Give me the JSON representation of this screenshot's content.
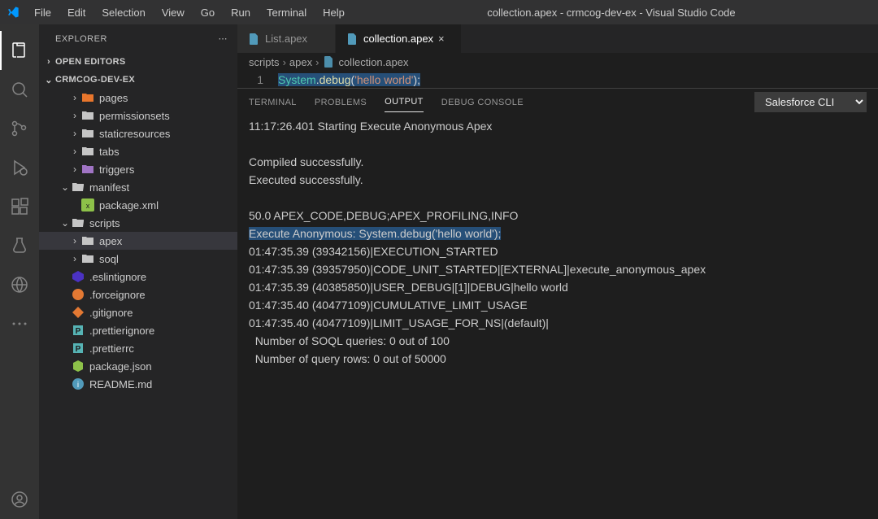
{
  "window": {
    "title": "collection.apex - crmcog-dev-ex - Visual Studio Code"
  },
  "menu": [
    "File",
    "Edit",
    "Selection",
    "View",
    "Go",
    "Run",
    "Terminal",
    "Help"
  ],
  "sidebar": {
    "title": "EXPLORER",
    "sections": {
      "open_editors": "OPEN EDITORS",
      "workspace": "CRMCOG-DEV-EX"
    },
    "tree": [
      {
        "label": "pages",
        "indent": 3,
        "chev": "right",
        "icon": "folder-orange"
      },
      {
        "label": "permissionsets",
        "indent": 3,
        "chev": "right",
        "icon": "folder-grey"
      },
      {
        "label": "staticresources",
        "indent": 3,
        "chev": "right",
        "icon": "folder-grey"
      },
      {
        "label": "tabs",
        "indent": 3,
        "chev": "right",
        "icon": "folder-grey"
      },
      {
        "label": "triggers",
        "indent": 3,
        "chev": "right",
        "icon": "folder-purple"
      },
      {
        "label": "manifest",
        "indent": 2,
        "chev": "down",
        "icon": "folder-open"
      },
      {
        "label": "package.xml",
        "indent": 3,
        "chev": "",
        "icon": "xml"
      },
      {
        "label": "scripts",
        "indent": 2,
        "chev": "down",
        "icon": "folder-open"
      },
      {
        "label": "apex",
        "indent": 3,
        "chev": "right",
        "icon": "folder-grey",
        "sel": true
      },
      {
        "label": "soql",
        "indent": 3,
        "chev": "right",
        "icon": "folder-grey"
      },
      {
        "label": ".eslintignore",
        "indent": 2,
        "chev": "",
        "icon": "eslint"
      },
      {
        "label": ".forceignore",
        "indent": 2,
        "chev": "",
        "icon": "force"
      },
      {
        "label": ".gitignore",
        "indent": 2,
        "chev": "",
        "icon": "git"
      },
      {
        "label": ".prettierignore",
        "indent": 2,
        "chev": "",
        "icon": "prettier"
      },
      {
        "label": ".prettierrc",
        "indent": 2,
        "chev": "",
        "icon": "prettier"
      },
      {
        "label": "package.json",
        "indent": 2,
        "chev": "",
        "icon": "node"
      },
      {
        "label": "README.md",
        "indent": 2,
        "chev": "",
        "icon": "info"
      }
    ]
  },
  "tabs": [
    {
      "label": "List.apex",
      "active": false
    },
    {
      "label": "collection.apex",
      "active": true
    }
  ],
  "breadcrumb": [
    "scripts",
    "apex",
    "collection.apex"
  ],
  "code": {
    "lineno": "1",
    "tokens": {
      "sys": "System",
      "dot": ".",
      "fn": "debug",
      "open": "(",
      "str": "'hello world'",
      "close": ");"
    }
  },
  "panel": {
    "tabs": [
      "TERMINAL",
      "PROBLEMS",
      "OUTPUT",
      "DEBUG CONSOLE"
    ],
    "active": 2,
    "dropdown": "Salesforce CLI",
    "output_lines": [
      "11:17:26.401 Starting Execute Anonymous Apex",
      "",
      "Compiled successfully.",
      "Executed successfully.",
      "",
      "50.0 APEX_CODE,DEBUG;APEX_PROFILING,INFO",
      "Execute Anonymous: System.debug('hello world');",
      "01:47:35.39 (39342156)|EXECUTION_STARTED",
      "01:47:35.39 (39357950)|CODE_UNIT_STARTED|[EXTERNAL]|execute_anonymous_apex",
      "01:47:35.39 (40385850)|USER_DEBUG|[1]|DEBUG|hello world",
      "01:47:35.40 (40477109)|CUMULATIVE_LIMIT_USAGE",
      "01:47:35.40 (40477109)|LIMIT_USAGE_FOR_NS|(default)|",
      "  Number of SOQL queries: 0 out of 100",
      "  Number of query rows: 0 out of 50000"
    ],
    "highlight_line": 6
  }
}
